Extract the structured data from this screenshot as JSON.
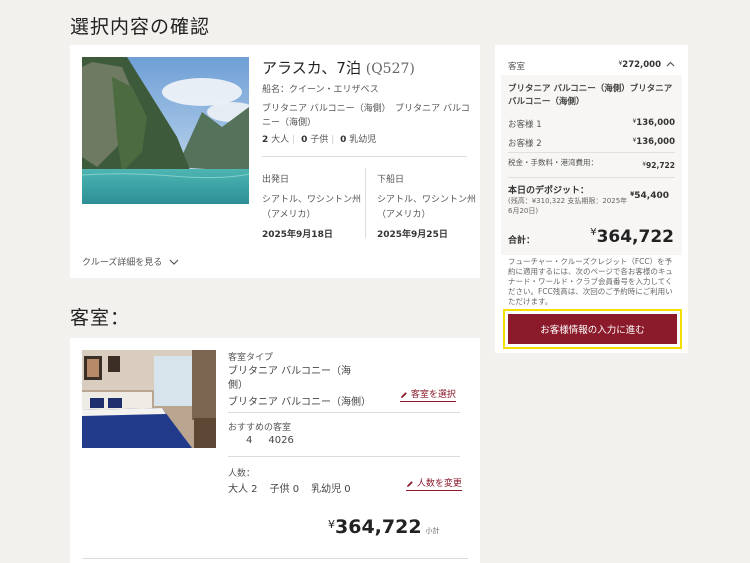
{
  "headings": {
    "confirm": "選択内容の確認",
    "room": "客室："
  },
  "cruise": {
    "title": "アラスカ、7泊",
    "code": "(Q527)",
    "ship": "船名：クイーン・エリザベス",
    "cabin": "ブリタニア バルコニー（海側）　ブリタニア バルコニー（海側）",
    "adults": "2",
    "adults_label": "大人",
    "children": "0",
    "children_label": "子供",
    "infants": "0",
    "infants_label": "乳幼児",
    "departure_label": "出発日",
    "departure_port": "シアトル、ワシントン州（アメリカ）",
    "departure_date": "2025年9月18日",
    "arrival_label": "下船日",
    "arrival_port": "シアトル、ワシントン州（アメリカ）",
    "arrival_date": "2025年9月25日",
    "details_link": "クルーズ詳細を見る"
  },
  "room": {
    "type_label": "客室タイプ",
    "type_value": "ブリタニア バルコニー（海側）",
    "type_value2": "ブリタニア バルコニー（海側）",
    "select_link": "客室を選択",
    "recommended_label": "おすすめの客室",
    "deck": "4",
    "cabin_no": "4026",
    "people_label": "人数：",
    "adults": "大人 2",
    "children": "子供 0",
    "infants": "乳幼児 0",
    "change_link": "人数を変更",
    "subtotal": "364,722",
    "subtotal_label": "小計"
  },
  "summary": {
    "room_label": "客室",
    "room_price": "272,000",
    "cabin_name": "ブリタニア バルコニー（海側）ブリタニア バルコニー（海側）",
    "guest1_label": "お客様 1",
    "guest1_price": "136,000",
    "guest2_label": "お客様 2",
    "guest2_price": "136,000",
    "tax_label": "税金・手数料・港湾費用：",
    "tax_price": "92,722",
    "deposit_label": "本日のデポジット：",
    "deposit_sub": "(残高：¥310,322 支払期限：2025年6月20日)",
    "deposit_price": "54,400",
    "total_label": "合計：",
    "total_price": "364,722",
    "fcc_note": "フューチャー・クルーズクレジット（FCC）を予約に適用するには、次のページで各お客様のキュナード・ワールド・クラブ会員番号を入力してください。FCC残高は、次回のご予約時にご利用いただけます。",
    "proceed_button": "お客様情報の入力に進む",
    "currency": "¥"
  },
  "colors": {
    "accent": "#8b1a2b",
    "highlight": "#f3e000",
    "background": "#f3f1ee"
  }
}
